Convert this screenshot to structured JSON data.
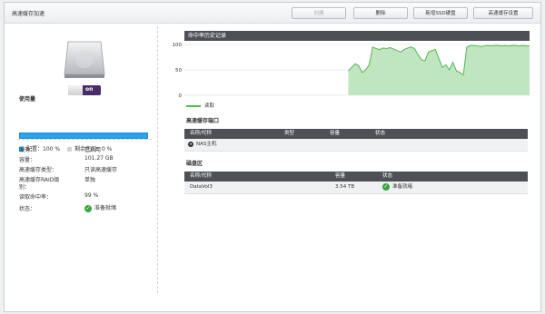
{
  "window": {
    "title": "高速缓存加速"
  },
  "toolbar": {
    "buttons": [
      {
        "label": "创建",
        "disabled": true
      },
      {
        "label": "删除",
        "disabled": false
      },
      {
        "label": "新增SSD硬盘",
        "disabled": false
      },
      {
        "label": "高速缓存设置",
        "disabled": false
      }
    ]
  },
  "left": {
    "toggle_label": "on",
    "usage_title": "使用量",
    "usage_fill_percent": 100,
    "legend_configured": "配置：100 %",
    "legend_free": "剩余空间：0 %",
    "colors": {
      "configured": "#2aa3e8",
      "free": "#d0d3d6"
    },
    "info": [
      {
        "label": "服务：",
        "value": "已启用"
      },
      {
        "label": "容量：",
        "value": "101.27 GB"
      },
      {
        "label": "高速缓存类型：",
        "value": "只读高速缓存"
      },
      {
        "label": "高速缓存RAID级",
        "label2": "别：",
        "value": "单独"
      },
      {
        "label": "读取命中率：",
        "value": "99 %"
      },
      {
        "label": "状态：",
        "value": "准备就绪",
        "status_icon": "check-circle-icon"
      }
    ]
  },
  "chart_section": {
    "header": "命中率历史记录",
    "legend": "读取"
  },
  "chart_data": {
    "type": "area",
    "ylim": [
      0,
      100
    ],
    "yticks": [
      "100",
      "50",
      "0"
    ],
    "grid": true,
    "series": [
      {
        "name": "读取",
        "color": "#55b555",
        "x": [
          0,
          1,
          2,
          3,
          4,
          5,
          6,
          7,
          8,
          9,
          10,
          11,
          12,
          13,
          14,
          15,
          16,
          17,
          18,
          19,
          20,
          21,
          22,
          23,
          24,
          25,
          26,
          27,
          28,
          29,
          30,
          31,
          32,
          33,
          34,
          35,
          36,
          37,
          38,
          39,
          40,
          41,
          42,
          43,
          44,
          45,
          46,
          47,
          48,
          49,
          50,
          51,
          52,
          53,
          54,
          55,
          56,
          57,
          58,
          59,
          60,
          61,
          62,
          63,
          64,
          65,
          66,
          67,
          68,
          69,
          70,
          71,
          72,
          73,
          74,
          75,
          76,
          77,
          78,
          79,
          80,
          81,
          82,
          83,
          84,
          85,
          86,
          87,
          88,
          89,
          90,
          91,
          92,
          93,
          94,
          95,
          96,
          97,
          98,
          99
        ],
        "values": [
          null,
          null,
          null,
          null,
          null,
          null,
          null,
          null,
          null,
          null,
          null,
          null,
          null,
          null,
          null,
          null,
          null,
          null,
          null,
          null,
          null,
          null,
          null,
          null,
          null,
          null,
          null,
          null,
          null,
          null,
          null,
          null,
          null,
          null,
          null,
          null,
          null,
          null,
          null,
          null,
          null,
          null,
          null,
          null,
          null,
          null,
          null,
          48,
          55,
          62,
          58,
          45,
          50,
          60,
          95,
          92,
          90,
          93,
          92,
          94,
          91,
          88,
          85,
          90,
          93,
          95,
          92,
          80,
          70,
          68,
          85,
          88,
          90,
          72,
          55,
          60,
          50,
          65,
          48,
          45,
          40,
          95,
          98,
          98,
          97,
          96,
          97,
          98,
          97,
          98,
          98,
          97,
          98,
          97,
          98,
          98,
          97,
          98,
          97,
          97
        ]
      }
    ]
  },
  "cache_port": {
    "title": "高速缓存端口",
    "columns": [
      "名称/代称",
      "类型",
      "容量",
      "状态"
    ],
    "rows": [
      {
        "name": "NAS主机",
        "type": "",
        "capacity": "",
        "status": ""
      }
    ]
  },
  "volumes": {
    "title": "磁盘区",
    "columns": [
      "名称/代称",
      "容量",
      "状态"
    ],
    "rows": [
      {
        "name": "DataVol3",
        "capacity": "3.54 TB",
        "status": "准备就绪"
      }
    ]
  }
}
